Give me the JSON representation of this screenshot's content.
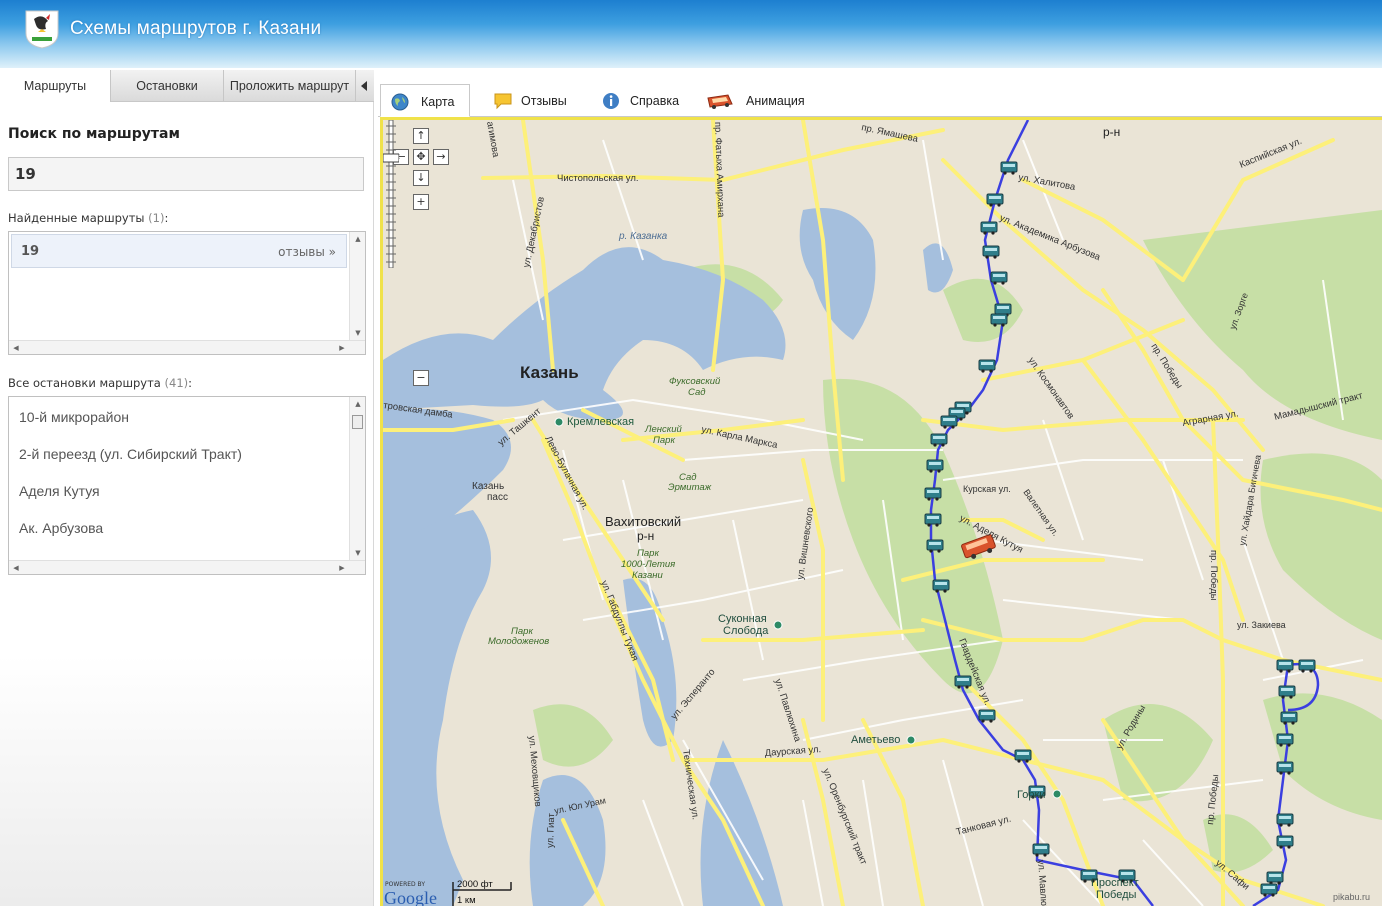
{
  "header": {
    "title": "Схемы маршрутов г. Казани"
  },
  "left_tabs": [
    {
      "label": "Маршруты"
    },
    {
      "label": "Остановки"
    },
    {
      "label": "Проложить маршрут"
    }
  ],
  "search": {
    "title": "Поиск по маршрутам",
    "value": "19"
  },
  "found": {
    "label": "Найденные маршруты",
    "count": "(1)",
    "colon": ":",
    "routes": [
      {
        "number": "19",
        "reviews_link": "отзывы »"
      }
    ]
  },
  "stops": {
    "label": "Все остановки маршрута",
    "count": "(41)",
    "colon": ":",
    "items": [
      "10-й микрорайон",
      "2-й переезд (ул. Сибирский Тракт)",
      "Аделя Кутуя",
      "Ак. Арбузова"
    ]
  },
  "map_tabs": [
    {
      "label": "Карта",
      "icon": "globe-icon"
    },
    {
      "label": "Отзывы",
      "icon": "comment-icon"
    },
    {
      "label": "Справка",
      "icon": "info-icon"
    },
    {
      "label": "Анимация",
      "icon": "bus-icon"
    }
  ],
  "map": {
    "labels": {
      "kazan": "Казань",
      "vakhitovsky": "Вахитовский",
      "rn": "р-н",
      "rn_top": "р-н",
      "kremlevskaya": "Кремлевская",
      "kazanka": "р. Казанка",
      "fuksovsky": "Фуксовский",
      "sad": "Сад",
      "lensky": "Ленский",
      "park": "Парк",
      "sad_ermitazh": "Сад",
      "ermitazh": "Эрмитаж",
      "park1000": "Парк",
      "let1000": "1000-Летия",
      "kazani": "Казани",
      "kazan_pass": "Казань",
      "pass": "пасс",
      "park_mol": "Парк",
      "molodezhen": "Молодоженов",
      "sukonnaya": "Суконная",
      "sloboda": "Слобода",
      "ametyevo": "Аметьево",
      "gorki": "Горки",
      "prospekt": "Проспект",
      "pobedy": "Победы",
      "st_chistopolskaya": "Чистопольская ул.",
      "st_dekabristov": "ул. Декабристов",
      "st_yamasheva": "пр. Ямашева",
      "st_fatykh": "пр. Фатыха Амирхана",
      "st_agimova": "агимова",
      "st_khalitova": "ул. Халитова",
      "st_arbuzova": "ул. Академика Арбузова",
      "st_kaspiyskaya": "Каспийская ул.",
      "st_kosmonavtov": "ул. Космонавтов",
      "st_pobedy": "пр. Победы",
      "st_zorge": "ул. Зорге",
      "st_agrarnaya": "Аграрная ул.",
      "st_mamadysh": "Мамадышский тракт",
      "st_karla": "ул. Карла Маркса",
      "st_tashkent": "ул. Ташкент",
      "st_levo": "Лево-Булачная ул.",
      "st_damba": "тровская дамба",
      "st_kurskaya": "Курская ул.",
      "st_valetnaya": "Валетная ул.",
      "st_adelya": "ул. Аделя Кутуя",
      "st_khaydara": "ул. Хайдара Бигичева",
      "st_pobedy2": "пр. Победы",
      "st_zakieva": "ул. Закиева",
      "st_vishnevskogo": "ул. Вишневского",
      "st_gabdully": "ул. Габдуллы Тукая",
      "st_esperanto": "ул. Эсперанто",
      "st_pavlyukhina": "ул. Павлюхина",
      "st_gvardeyskaya": "Гвардейская ул.",
      "st_daurskaya": "Даурская ул.",
      "st_orenburgsky": "ул. Оренбургский тракт",
      "st_tankovaya": "Танковая ул.",
      "st_rodiny": "ул. Родины",
      "st_pobedy3": "пр. Победы",
      "st_safiullina": "ул. Сафи",
      "st_mavlyutova": "ул. Мавлютова",
      "st_mekhovshchikov": "ул. Меховщиков",
      "st_yuzhny": "ул. Юл Урам",
      "st_tekhnicheskaya": "Техническая ул.",
      "st_kalinina": "ул. Гиат"
    },
    "scale": {
      "ft": "2000 фт",
      "km": "1 км"
    },
    "powered": "POWERED BY",
    "google": "Google",
    "watermark": "pikabu.ru",
    "colors": {
      "route": "#3b3fe0",
      "water": "#a5bfdd",
      "park": "#c7dfa6",
      "road_major": "#fdf07a",
      "road_minor": "#ffffff",
      "land": "#eae4d6"
    }
  }
}
